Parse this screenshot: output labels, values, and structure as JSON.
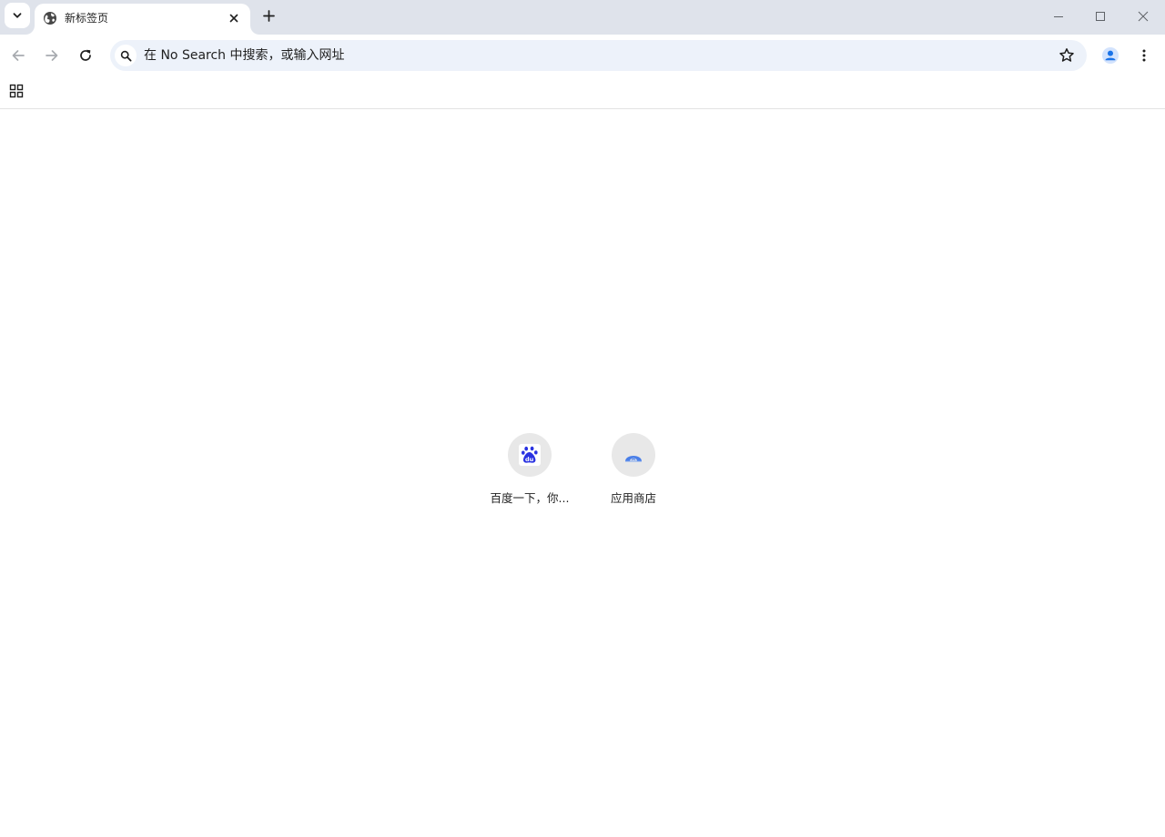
{
  "tabstrip": {
    "tabs": [
      {
        "title": "新标签页",
        "favicon": "globe-icon",
        "active": true
      }
    ],
    "controls": {
      "tab_search_icon": "chevron-down-icon",
      "new_tab_icon": "plus-icon",
      "minimize_icon": "minimize-icon",
      "maximize_icon": "maximize-icon",
      "close_icon": "close-icon"
    }
  },
  "toolbar": {
    "back_icon": "arrow-left-icon",
    "forward_icon": "arrow-right-icon",
    "reload_icon": "reload-icon",
    "omnibox": {
      "placeholder": "在 No Search 中搜索，或输入网址",
      "value": "",
      "search_icon": "search-icon",
      "bookmark_icon": "star-icon"
    },
    "profile_icon": "profile-icon",
    "menu_icon": "more-vertical-icon"
  },
  "bookmarks_bar": {
    "apps_icon": "apps-grid-icon"
  },
  "new_tab_page": {
    "shortcuts": [
      {
        "label": "百度一下，你...",
        "icon": "baidu-icon"
      },
      {
        "label": "应用商店",
        "icon": "app-store-icon"
      }
    ]
  },
  "colors": {
    "tabstrip_bg": "#dfe3eb",
    "omnibox_bg": "#edf2fa",
    "tile_bg": "#e8e8e8",
    "baidu_blue": "#2932e1",
    "store_blue": "#4a7fe8",
    "profile_blue": "#1a73e8",
    "icon_gray": "#474747"
  }
}
